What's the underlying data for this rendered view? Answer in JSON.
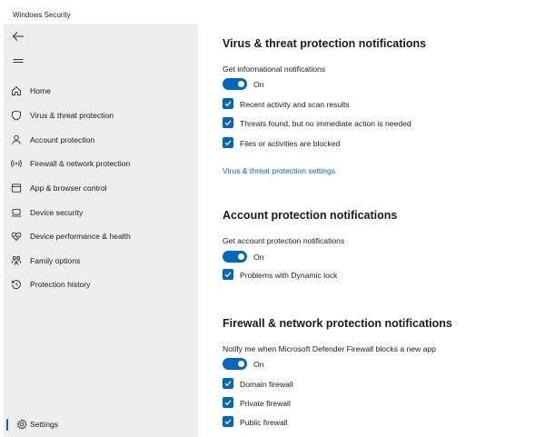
{
  "window": {
    "title": "Windows Security"
  },
  "sidebar": {
    "back_icon": "back-arrow-icon",
    "menu_icon": "hamburger-icon",
    "items": [
      {
        "label": "Home",
        "icon": "home-icon"
      },
      {
        "label": "Virus & threat protection",
        "icon": "shield-icon"
      },
      {
        "label": "Account protection",
        "icon": "person-icon"
      },
      {
        "label": "Firewall & network protection",
        "icon": "wifi-signal-icon"
      },
      {
        "label": "App & browser control",
        "icon": "browser-window-icon"
      },
      {
        "label": "Device security",
        "icon": "laptop-icon"
      },
      {
        "label": "Device performance & health",
        "icon": "heart-pulse-icon"
      },
      {
        "label": "Family options",
        "icon": "family-icon"
      },
      {
        "label": "Protection history",
        "icon": "history-icon"
      }
    ],
    "settings": {
      "label": "Settings",
      "icon": "gear-icon"
    }
  },
  "sections": {
    "virus": {
      "title": "Virus & threat protection notifications",
      "subtitle": "Get informational notifications",
      "toggle_state": "On",
      "checkboxes": [
        "Recent activity and scan results",
        "Threats found, but no immediate action is needed",
        "Files or activities are blocked"
      ],
      "link": "Virus & threat protection settings"
    },
    "account": {
      "title": "Account protection notifications",
      "subtitle": "Get account protection notifications",
      "toggle_state": "On",
      "checkboxes": [
        "Problems with Dynamic lock"
      ]
    },
    "firewall": {
      "title": "Firewall & network protection notifications",
      "subtitle": "Notify me when Microsoft Defender Firewall blocks a new app",
      "toggle_state": "On",
      "checkboxes": [
        "Domain firewall",
        "Private firewall",
        "Public firewall"
      ]
    }
  },
  "colors": {
    "accent": "#0067c0",
    "sidebar_bg": "#eeeeee"
  }
}
